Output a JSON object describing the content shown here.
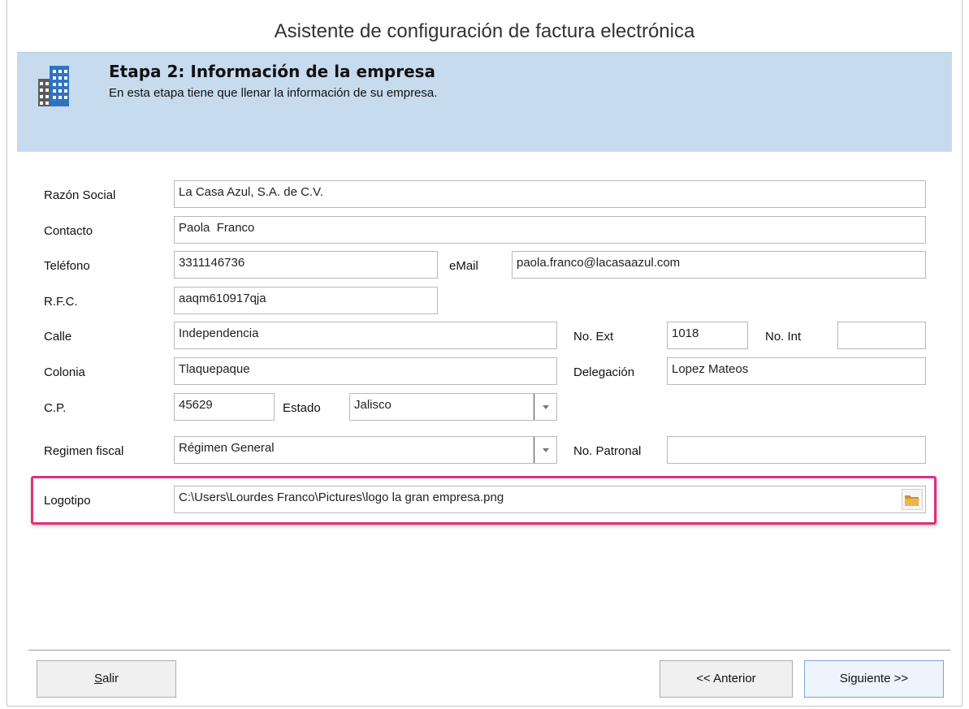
{
  "window": {
    "title": "Asistente de configuración de factura electrónica"
  },
  "banner": {
    "icon": "building-icon",
    "title": "Etapa 2: Información de la empresa",
    "subtitle": "En esta etapa tiene que llenar la información de su empresa."
  },
  "form": {
    "razon_social": {
      "label": "Razón Social",
      "value": "La Casa Azul, S.A. de C.V."
    },
    "contacto": {
      "label": "Contacto",
      "value": "Paola  Franco"
    },
    "telefono": {
      "label": "Teléfono",
      "value": "3311146736"
    },
    "email": {
      "label": "eMail",
      "value": "paola.franco@lacasaazul.com"
    },
    "rfc": {
      "label": "R.F.C.",
      "value": "aaqm610917qja"
    },
    "calle": {
      "label": "Calle",
      "value": "Independencia"
    },
    "no_ext": {
      "label": "No. Ext",
      "value": "1018"
    },
    "no_int": {
      "label": "No. Int",
      "value": ""
    },
    "colonia": {
      "label": "Colonia",
      "value": "Tlaquepaque"
    },
    "delegacion": {
      "label": "Delegación",
      "value": "Lopez Mateos"
    },
    "cp": {
      "label": "C.P.",
      "value": "45629"
    },
    "estado": {
      "label": "Estado",
      "value": "Jalisco"
    },
    "regimen": {
      "label": "Regimen fiscal",
      "value": "Régimen General"
    },
    "no_patronal": {
      "label": "No. Patronal",
      "value": ""
    },
    "logotipo": {
      "label": "Logotipo",
      "value": "C:\\Users\\Lourdes Franco\\Pictures\\logo la gran empresa.png",
      "browse_icon": "folder-icon"
    }
  },
  "colors": {
    "banner_bg": "#c7dbef",
    "highlight": "#e0307e"
  },
  "buttons": {
    "salir_mnemonic": "S",
    "salir_rest": "alir",
    "anterior": "<< Anterior",
    "siguiente": "Siguiente >>"
  }
}
